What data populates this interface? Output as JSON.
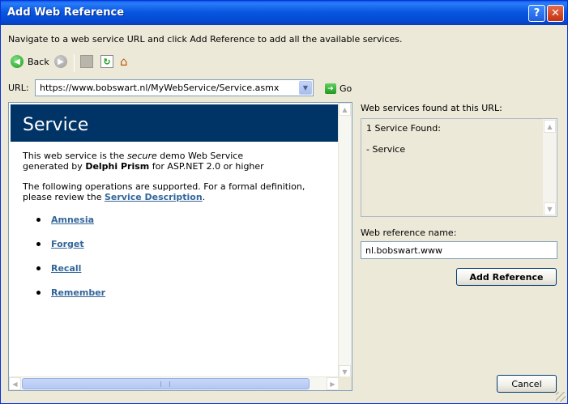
{
  "window": {
    "title": "Add Web Reference",
    "help_glyph": "?",
    "close_glyph": "✕"
  },
  "instruction": "Navigate to a web service URL and click Add Reference to add all the available services.",
  "toolbar": {
    "back_label": "Back",
    "icons": [
      "back-arrow-icon",
      "forward-arrow-icon",
      "stop-icon",
      "refresh-icon",
      "home-icon"
    ]
  },
  "url": {
    "label": "URL:",
    "value": "https://www.bobswart.nl/MyWebService/Service.asmx"
  },
  "go_label": "Go",
  "browser": {
    "page_title": "Service",
    "intro_1a": "This web service is the ",
    "intro_1_em": "secure",
    "intro_1b": " demo Web Service",
    "intro_2a": "generated by ",
    "intro_2_strong": "Delphi Prism",
    "intro_2b": " for ASP.NET 2.0 or higher",
    "ops_1": "The following operations are supported. For a formal definition,",
    "ops_2a": "please review the ",
    "ops_link": "Service Description",
    "ops_2b": ".",
    "operations": [
      "Amnesia",
      "Forget",
      "Recall",
      "Remember"
    ]
  },
  "found": {
    "label": "Web services found at this URL:",
    "line1": "1 Service Found:",
    "line2": "- Service"
  },
  "reference_name": {
    "label": "Web reference name:",
    "value": "nl.bobswart.www"
  },
  "buttons": {
    "add_reference": "Add Reference",
    "cancel": "Cancel"
  },
  "colors": {
    "titlebar": "#0a5de8",
    "page_header": "#003366",
    "link": "#336699",
    "dialog_bg": "#ece9d8"
  }
}
